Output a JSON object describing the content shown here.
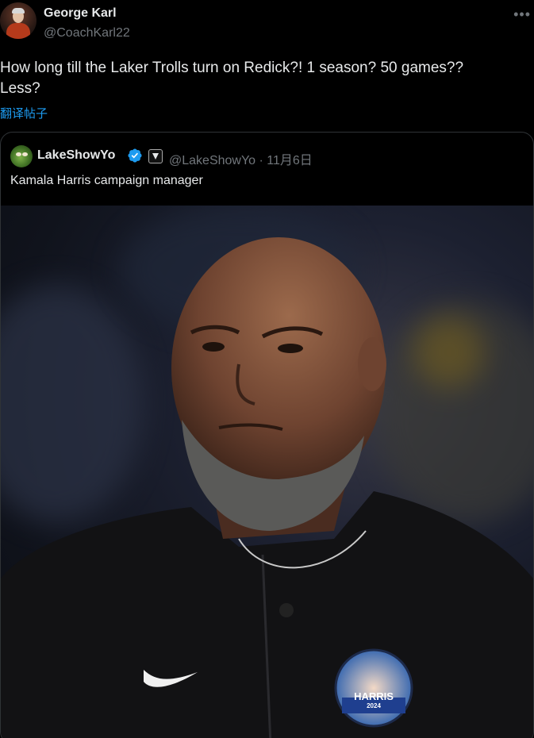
{
  "post": {
    "author_name": "George Karl",
    "author_handle": "@CoachKarl22",
    "text_line1": "How long till the Laker Trolls turn on Redick?! 1 season? 50 games??",
    "text_line2": "Less?",
    "translate_label": "翻译帖子",
    "more_icon": "more-horizontal-icon"
  },
  "quote": {
    "author_name": "LakeShowYo",
    "author_handle": "@LakeShowYo",
    "separator": "·",
    "date": "11月6日",
    "text": "Kamala Harris campaign manager",
    "verified_icon": "verified-badge-icon"
  },
  "image": {
    "button_text": "HARRIS",
    "button_year": "2024"
  },
  "colors": {
    "accent": "#1d9bf0",
    "text_primary": "#e7e9ea",
    "text_secondary": "#71767b",
    "border": "#2f3336",
    "background": "#000000"
  }
}
